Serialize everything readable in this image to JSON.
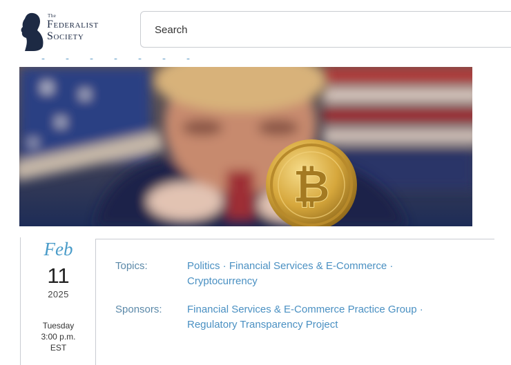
{
  "header": {
    "logo": {
      "the": "The",
      "line1": "Federalist",
      "line2": "Society"
    },
    "search": {
      "placeholder": "Search"
    }
  },
  "hero": {
    "alt": "Blurred portrait behind a golden bitcoin coin in front of an American flag"
  },
  "event_date": {
    "month": "Feb",
    "day": "11",
    "year": "2025",
    "weekday": "Tuesday",
    "time": "3:00 p.m.",
    "timezone": "EST"
  },
  "meta": {
    "topics_label": "Topics:",
    "topics": [
      "Politics",
      "Financial Services & E-Commerce",
      "Cryptocurrency"
    ],
    "sponsors_label": "Sponsors:",
    "sponsors": [
      "Financial Services & E-Commerce Practice Group",
      "Regulatory Transparency Project"
    ]
  },
  "colors": {
    "accent": "#4a90c2",
    "label": "#5a88a8",
    "navy": "#1d2a44",
    "border": "#c9ccd1",
    "coin_gold": "#d6a73c"
  }
}
